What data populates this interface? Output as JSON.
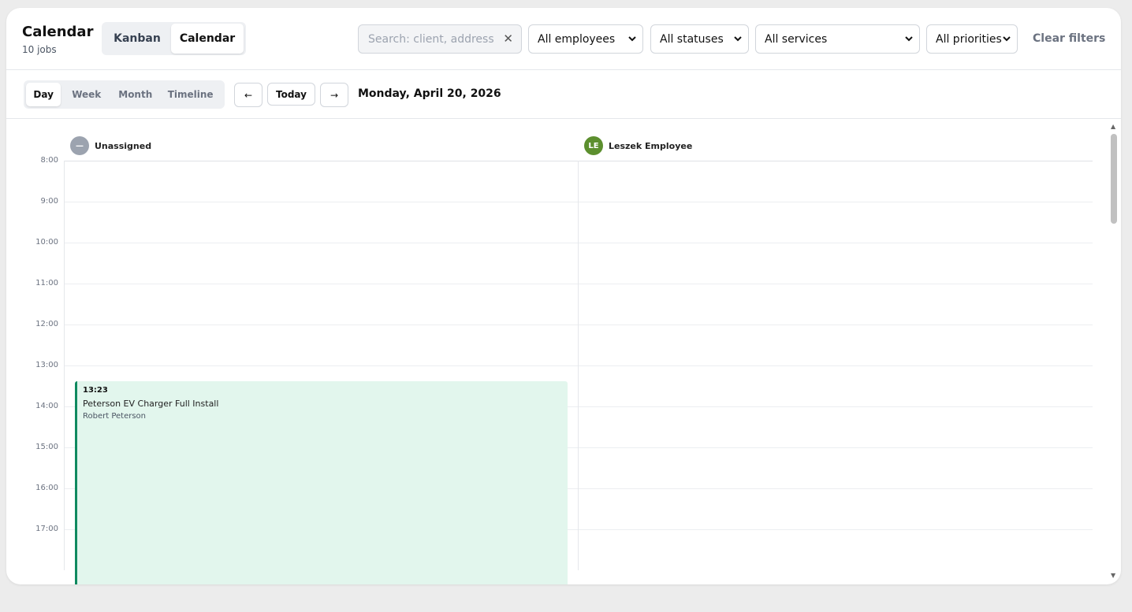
{
  "header": {
    "title": "Calendar",
    "job_count": "10 jobs",
    "views": [
      {
        "label": "Kanban",
        "active": false
      },
      {
        "label": "Calendar",
        "active": true
      }
    ],
    "search": {
      "placeholder": "Search: client, address, n",
      "value": ""
    },
    "filters": {
      "employees": "All employees",
      "statuses": "All statuses",
      "services": "All services",
      "priorities": "All priorities"
    },
    "clear_filters": "Clear filters"
  },
  "toolbar": {
    "ranges": [
      {
        "label": "Day",
        "active": true
      },
      {
        "label": "Week",
        "active": false
      },
      {
        "label": "Month",
        "active": false
      },
      {
        "label": "Timeline",
        "active": false
      }
    ],
    "prev": "←",
    "today": "Today",
    "next": "→",
    "date": "Monday, April 20, 2026"
  },
  "calendar": {
    "columns": [
      {
        "name": "Unassigned",
        "avatar": "—",
        "color": "#9ca3af"
      },
      {
        "name": "Leszek Employee",
        "avatar": "LE",
        "color": "#5c8f2e"
      }
    ],
    "hours": [
      "8:00",
      "9:00",
      "10:00",
      "11:00",
      "12:00",
      "13:00",
      "14:00",
      "15:00",
      "16:00",
      "17:00"
    ],
    "events": [
      {
        "time": "13:23",
        "title": "Peterson EV Charger Full Install",
        "client": "Robert Peterson",
        "column": "Unassigned",
        "color": "#0f8a5f",
        "background": "#e2f6ed"
      }
    ]
  }
}
